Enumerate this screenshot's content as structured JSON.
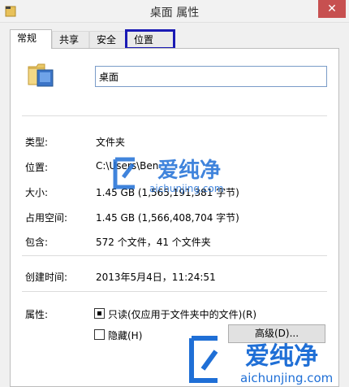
{
  "window": {
    "title": "桌面 属性",
    "close_glyph": "✕"
  },
  "tabs": [
    {
      "label": "常规",
      "active": true
    },
    {
      "label": "共享",
      "active": false
    },
    {
      "label": "安全",
      "active": false
    },
    {
      "label": "位置",
      "active": false,
      "highlighted": true
    }
  ],
  "general": {
    "folder_name": "桌面",
    "fields": [
      {
        "label": "类型:",
        "value": "文件夹"
      },
      {
        "label": "位置:",
        "value": "C:\\Users\\Ben"
      },
      {
        "label": "大小:",
        "value": "1.45 GB (1,565,191,381 字节)"
      },
      {
        "label": "占用空间:",
        "value": "1.45 GB (1,566,408,704 字节)"
      },
      {
        "label": "包含:",
        "value": "572 个文件，41 个文件夹"
      },
      {
        "label": "创建时间:",
        "value": "2013年5月4日，11:24:51"
      }
    ],
    "attributes_label": "属性:",
    "readonly_label": "只读(仅应用于文件夹中的文件)(R)",
    "hidden_label": "隐藏(H)",
    "advanced_label": "高级(D)..."
  },
  "watermark": {
    "brand": "爱纯净",
    "url": "aichunjing.com"
  },
  "colors": {
    "highlight_box": "#1a1ab4",
    "close_button": "#c75050",
    "watermark_blue": "#1f6fd6"
  }
}
